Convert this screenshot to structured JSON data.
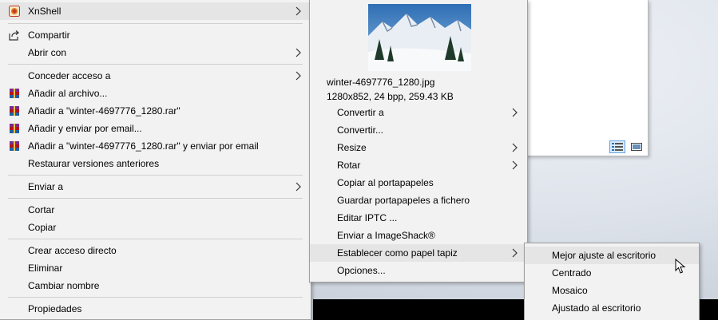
{
  "main_menu": {
    "items": [
      {
        "label": "XnShell",
        "icon": "xnshell-icon",
        "submenu": true
      },
      {
        "label": "Compartir",
        "icon": "share-icon"
      },
      {
        "label": "Abrir con",
        "submenu": true
      },
      {
        "label": "Conceder acceso a",
        "submenu": true
      },
      {
        "label": "Añadir al archivo...",
        "icon": "winrar-icon"
      },
      {
        "label": "Añadir a \"winter-4697776_1280.rar\"",
        "icon": "winrar-icon"
      },
      {
        "label": "Añadir y enviar por email...",
        "icon": "winrar-icon"
      },
      {
        "label": "Añadir a \"winter-4697776_1280.rar\" y enviar por email",
        "icon": "winrar-icon"
      },
      {
        "label": "Restaurar versiones anteriores"
      },
      {
        "label": "Enviar a",
        "submenu": true
      },
      {
        "label": "Cortar"
      },
      {
        "label": "Copiar"
      },
      {
        "label": "Crear acceso directo"
      },
      {
        "label": "Eliminar"
      },
      {
        "label": "Cambiar nombre"
      },
      {
        "label": "Propiedades"
      }
    ]
  },
  "xnshell_menu": {
    "preview_alt": "snowy-mountain-thumbnail",
    "filename": "winter-4697776_1280.jpg",
    "file_info": "1280x852, 24 bpp, 259.43 KB",
    "items": [
      {
        "label": "Convertir a",
        "submenu": true
      },
      {
        "label": "Convertir..."
      },
      {
        "label": "Resize",
        "submenu": true
      },
      {
        "label": "Rotar",
        "submenu": true
      },
      {
        "label": "Copiar al portapapeles"
      },
      {
        "label": "Guardar portapapeles a fichero"
      },
      {
        "label": "Editar IPTC ..."
      },
      {
        "label": "Enviar a ImageShack®"
      },
      {
        "label": "Establecer como papel tapiz",
        "submenu": true,
        "highlighted": true
      },
      {
        "label": "Opciones..."
      }
    ]
  },
  "wallpaper_menu": {
    "items": [
      {
        "label": "Mejor ajuste al escritorio",
        "highlighted": true
      },
      {
        "label": "Centrado"
      },
      {
        "label": "Mosaico"
      },
      {
        "label": "Ajustado al escritorio"
      }
    ]
  },
  "colors": {
    "menu_bg": "#f2f2f2",
    "highlight": "#e5e5e5",
    "separator": "#cfcfcf",
    "winrar_red": "#b5121b"
  }
}
